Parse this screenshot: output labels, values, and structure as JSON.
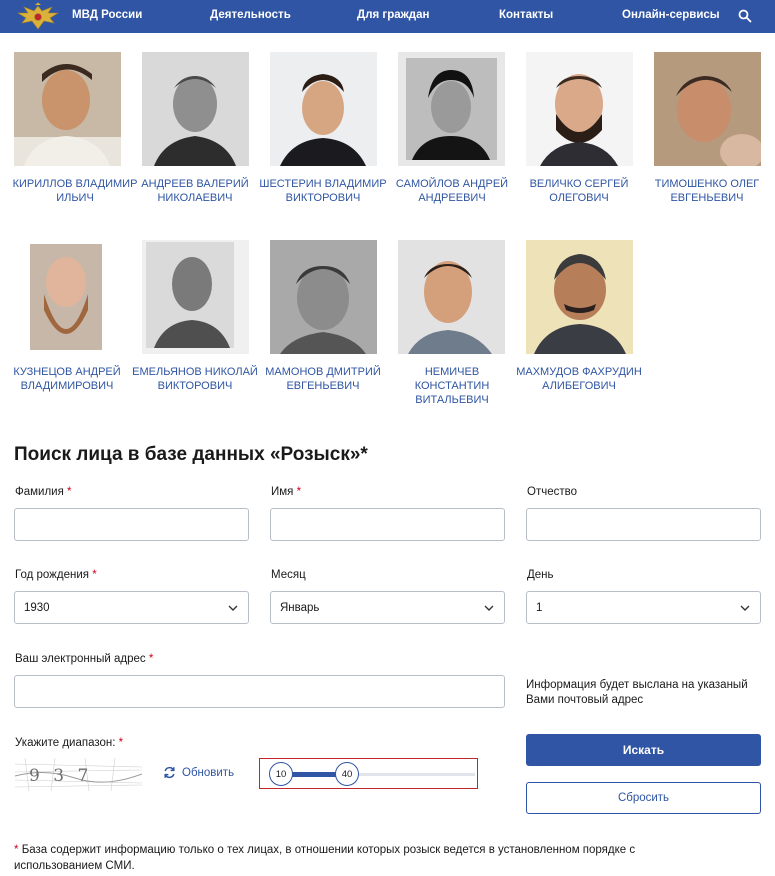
{
  "nav": {
    "brand": "МВД России",
    "items": [
      "Деятельность",
      "Для граждан",
      "Контакты",
      "Онлайн-сервисы"
    ]
  },
  "persons": [
    {
      "name": "КИРИЛЛОВ ВЛАДИМИР ИЛЬИЧ"
    },
    {
      "name": "АНДРЕЕВ ВАЛЕРИЙ НИКОЛАЕВИЧ"
    },
    {
      "name": "ШЕСТЕРИН ВЛАДИМИР ВИКТОРОВИЧ"
    },
    {
      "name": "САМОЙЛОВ АНДРЕЙ АНДРЕЕВИЧ"
    },
    {
      "name": "ВЕЛИЧКО СЕРГЕЙ ОЛЕГОВИЧ"
    },
    {
      "name": "ТИМОШЕНКО ОЛЕГ ЕВГЕНЬЕВИЧ"
    },
    {
      "name": "КУЗНЕЦОВ АНДРЕЙ ВЛАДИМИРОВИЧ"
    },
    {
      "name": "ЕМЕЛЬЯНОВ НИКОЛАЙ ВИКТОРОВИЧ"
    },
    {
      "name": "МАМОНОВ ДМИТРИЙ ЕВГЕНЬЕВИЧ"
    },
    {
      "name": "НЕМИЧЕВ КОНСТАНТИН ВИТАЛЬЕВИЧ"
    },
    {
      "name": "МАХМУДОВ ФАХРУДИН АЛИБЕГОВИЧ"
    }
  ],
  "form": {
    "title": "Поиск лица в базе данных «Розыск»*",
    "last_name_label": "Фамилия",
    "first_name_label": "Имя",
    "patronymic_label": "Отчество",
    "last_name_value": "",
    "first_name_value": "",
    "patronymic_value": "",
    "birth_year_label": "Год рождения",
    "birth_year_value": "1930",
    "month_label": "Месяц",
    "month_value": "Январь",
    "day_label": "День",
    "day_value": "1",
    "email_label": "Ваш электронный адрес",
    "email_value": "",
    "info_text": "Информация будет выслана на указаный Вами почтовый адрес",
    "range_label": "Укажите диапазон:",
    "captcha_text": "9 3 7",
    "refresh_label": "Обновить",
    "range_min": 10,
    "range_max": 40,
    "search_button": "Искать",
    "reset_button": "Сбросить",
    "required_mark": "*"
  },
  "footnote": "База содержит информацию только о тех лицах, в отношении которых розыск ведется в установленном порядке с использованием СМИ.",
  "colors": {
    "brand_blue": "#2f55a4",
    "required_red": "#d0021b",
    "range_border": "#c0272d"
  },
  "icons": {
    "logo": "double-headed-eagle-emblem",
    "search": "magnifier",
    "select_arrow": "chevron-down",
    "refresh": "circular-arrows"
  }
}
